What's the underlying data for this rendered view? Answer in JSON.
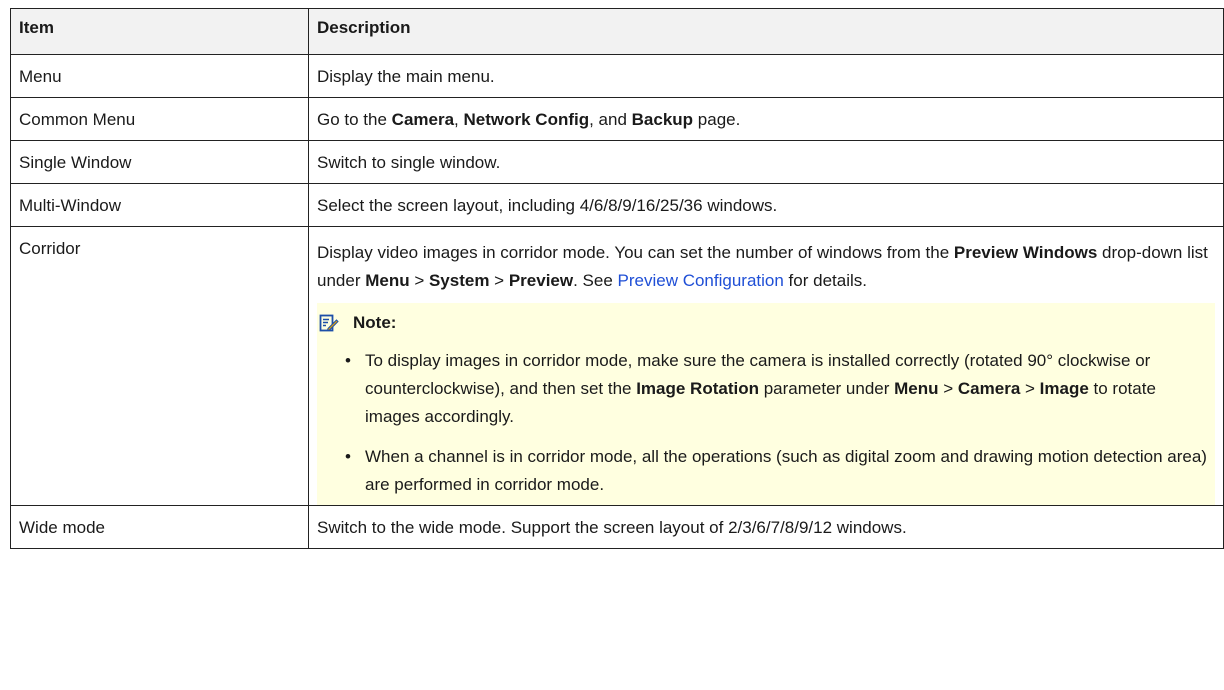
{
  "table": {
    "headers": [
      "Item",
      "Description"
    ],
    "rows": {
      "menu": {
        "item": "Menu",
        "description": "Display the main menu."
      },
      "common_menu": {
        "item": "Common Menu",
        "d0": "Go to the ",
        "d1": "Camera",
        "d2": ", ",
        "d3": "Network Config",
        "d4": ", and ",
        "d5": "Backup",
        "d6": " page."
      },
      "single_window": {
        "item": "Single Window",
        "description": "Switch to single window."
      },
      "multi_window": {
        "item": "Multi-Window",
        "description": "Select the screen layout, including 4/6/8/9/16/25/36 windows."
      },
      "corridor": {
        "item": "Corridor",
        "p0": "Display video images in corridor mode. You can set the number of windows from the ",
        "p1": "Preview Windows",
        "p2": " drop-down list under ",
        "p3": "Menu",
        "p4": " > ",
        "p5": "System",
        "p6": " > ",
        "p7": "Preview",
        "p8": ". See ",
        "link": "Preview Configuration",
        "p9": " for details.",
        "note_label": "Note:",
        "b1_0": "To display images in corridor mode, make sure the camera is installed correctly (rotated 90° clockwise or counterclockwise), and then set the ",
        "b1_1": "Image Rotation",
        "b1_2": " parameter under ",
        "b1_3": "Menu",
        "b1_4": " > ",
        "b1_5": "Camera",
        "b1_6": " > ",
        "b1_7": "Image",
        "b1_8": " to rotate images accordingly.",
        "b2": "When a channel is in corridor mode, all the operations (such as digital zoom and drawing motion detection area) are performed in corridor mode."
      },
      "wide_mode": {
        "item": "Wide mode",
        "description": "Switch to the wide mode. Support the screen layout of 2/3/6/7/8/9/12 windows."
      }
    }
  },
  "colors": {
    "link": "#1f4fd6",
    "note_bg": "#ffffe0",
    "header_bg": "#f2f2f2",
    "note_icon": "#1d4fa8"
  },
  "icons": {
    "note": "note-pencil-icon"
  }
}
